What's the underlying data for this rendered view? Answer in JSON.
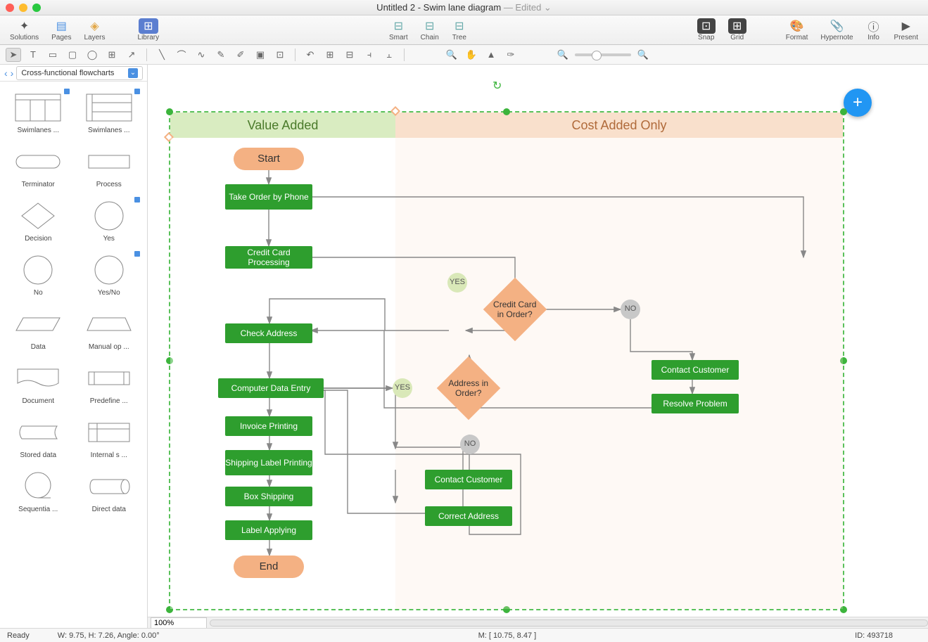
{
  "window": {
    "title_main": "Untitled 2 - Swim lane diagram",
    "title_suffix": " — Edited"
  },
  "toolbar": {
    "solutions": "Solutions",
    "pages": "Pages",
    "layers": "Layers",
    "library": "Library",
    "smart": "Smart",
    "chain": "Chain",
    "tree": "Tree",
    "snap": "Snap",
    "grid": "Grid",
    "format": "Format",
    "hypernote": "Hypernote",
    "info": "Info",
    "present": "Present"
  },
  "library": {
    "selector": "Cross-functional flowcharts",
    "shapes": [
      {
        "label": "Swimlanes ...",
        "type": "swimlanes-v"
      },
      {
        "label": "Swimlanes ...",
        "type": "swimlanes-h"
      },
      {
        "label": "Terminator",
        "type": "terminator"
      },
      {
        "label": "Process",
        "type": "process"
      },
      {
        "label": "Decision",
        "type": "decision"
      },
      {
        "label": "Yes",
        "type": "circle"
      },
      {
        "label": "No",
        "type": "circle"
      },
      {
        "label": "Yes/No",
        "type": "circle"
      },
      {
        "label": "Data",
        "type": "data"
      },
      {
        "label": "Manual op ...",
        "type": "manual"
      },
      {
        "label": "Document",
        "type": "document"
      },
      {
        "label": "Predefine ...",
        "type": "predefined"
      },
      {
        "label": "Stored data",
        "type": "stored"
      },
      {
        "label": "Internal s ...",
        "type": "internal"
      },
      {
        "label": "Sequentia ...",
        "type": "sequential"
      },
      {
        "label": "Direct data",
        "type": "direct"
      }
    ]
  },
  "swimlanes": {
    "value_added": "Value Added",
    "cost_added": "Cost Added Only"
  },
  "nodes": {
    "start": "Start",
    "take_order": "Take Order by Phone",
    "credit_processing": "Credit Card Processing",
    "check_address": "Check Address",
    "computer_data": "Computer Data Entry",
    "invoice": "Invoice Printing",
    "shipping_label": "Shipping Label Printing",
    "box_shipping": "Box Shipping",
    "label_applying": "Label Applying",
    "end": "End",
    "credit_decision": "Credit Card in Order?",
    "address_decision": "Address in Order?",
    "contact_customer1": "Contact Customer",
    "resolve": "Resolve Problem",
    "contact_customer2": "Contact Customer",
    "correct_address": "Correct Address",
    "yes": "YES",
    "no": "NO"
  },
  "zoom_value": "100%",
  "status": {
    "ready": "Ready",
    "dims": "W: 9.75,  H: 7.26,  Angle: 0.00°",
    "mouse": "M: [ 10.75, 8.47 ]",
    "id": "ID: 493718"
  }
}
